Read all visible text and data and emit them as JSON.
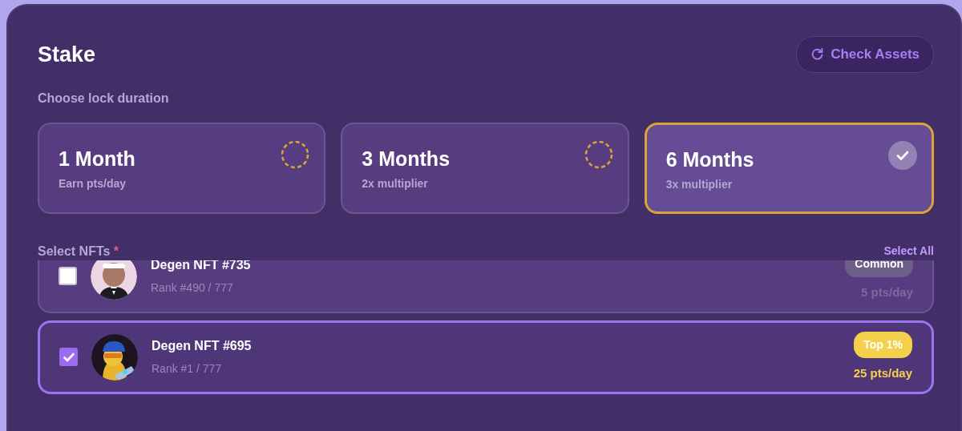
{
  "title": "Stake",
  "check_assets_button": "Check Assets",
  "duration_label": "Choose lock duration",
  "durations": [
    {
      "title": "1 Month",
      "subtitle": "Earn pts/day",
      "selected": false
    },
    {
      "title": "3 Months",
      "subtitle": "2x multiplier",
      "selected": false
    },
    {
      "title": "6 Months",
      "subtitle": "3x multiplier",
      "selected": true
    }
  ],
  "nfts_label": "Select NFTs",
  "required_mark": "*",
  "select_all": "Select All",
  "nfts": [
    {
      "name": "Degen NFT #735",
      "rank": "Rank #490 / 777",
      "checked": false,
      "tier": "Common",
      "color": "#6e5e8a",
      "points": "5 pts/day"
    },
    {
      "name": "Degen NFT #695",
      "rank": "Rank #1 / 777",
      "checked": true,
      "tier": "Top 1%",
      "color": "#f5d04a",
      "points": "25 pts/day"
    }
  ]
}
